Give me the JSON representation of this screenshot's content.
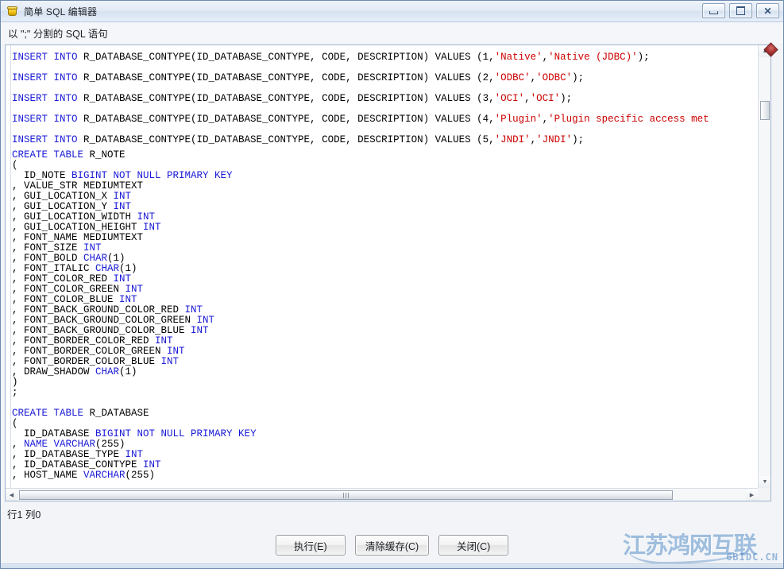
{
  "window": {
    "title": "简单 SQL 编辑器",
    "icon": "java-app-icon",
    "controls": {
      "minimize": "最小化",
      "maximize": "最大化",
      "close": "关闭"
    }
  },
  "label": {
    "text": "以 \";\" 分割的 SQL 语句"
  },
  "editor": {
    "lines": [
      {
        "spacing": "tall",
        "tokens": [
          {
            "t": "INSERT INTO ",
            "c": "kw"
          },
          {
            "t": "R_DATABASE_CONTYPE(ID_DATABASE_CONTYPE, CODE, DESCRIPTION) VALUES (1,",
            "c": "pl"
          },
          {
            "t": "'Native'",
            "c": "str"
          },
          {
            "t": ",",
            "c": "pl"
          },
          {
            "t": "'Native (JDBC)'",
            "c": "str"
          },
          {
            "t": ");",
            "c": "pl"
          }
        ]
      },
      {
        "spacing": "tall",
        "tokens": [
          {
            "t": "INSERT INTO ",
            "c": "kw"
          },
          {
            "t": "R_DATABASE_CONTYPE(ID_DATABASE_CONTYPE, CODE, DESCRIPTION) VALUES (2,",
            "c": "pl"
          },
          {
            "t": "'ODBC'",
            "c": "str"
          },
          {
            "t": ",",
            "c": "pl"
          },
          {
            "t": "'ODBC'",
            "c": "str"
          },
          {
            "t": ");",
            "c": "pl"
          }
        ]
      },
      {
        "spacing": "tall",
        "tokens": [
          {
            "t": "INSERT INTO ",
            "c": "kw"
          },
          {
            "t": "R_DATABASE_CONTYPE(ID_DATABASE_CONTYPE, CODE, DESCRIPTION) VALUES (3,",
            "c": "pl"
          },
          {
            "t": "'OCI'",
            "c": "str"
          },
          {
            "t": ",",
            "c": "pl"
          },
          {
            "t": "'OCI'",
            "c": "str"
          },
          {
            "t": ");",
            "c": "pl"
          }
        ]
      },
      {
        "spacing": "tall",
        "tokens": [
          {
            "t": "INSERT INTO ",
            "c": "kw"
          },
          {
            "t": "R_DATABASE_CONTYPE(ID_DATABASE_CONTYPE, CODE, DESCRIPTION) VALUES (4,",
            "c": "pl"
          },
          {
            "t": "'Plugin'",
            "c": "str"
          },
          {
            "t": ",",
            "c": "pl"
          },
          {
            "t": "'Plugin specific access met",
            "c": "str"
          }
        ]
      },
      {
        "spacing": "tall",
        "tokens": [
          {
            "t": "INSERT INTO ",
            "c": "kw"
          },
          {
            "t": "R_DATABASE_CONTYPE(ID_DATABASE_CONTYPE, CODE, DESCRIPTION) VALUES (5,",
            "c": "pl"
          },
          {
            "t": "'JNDI'",
            "c": "str"
          },
          {
            "t": ",",
            "c": "pl"
          },
          {
            "t": "'JNDI'",
            "c": "str"
          },
          {
            "t": ");",
            "c": "pl"
          }
        ]
      },
      {
        "spacing": "normal",
        "tokens": [
          {
            "t": "CREATE TABLE ",
            "c": "kw"
          },
          {
            "t": "R_NOTE",
            "c": "pl"
          }
        ]
      },
      {
        "spacing": "normal",
        "tokens": [
          {
            "t": "(",
            "c": "pl"
          }
        ]
      },
      {
        "spacing": "normal",
        "tokens": [
          {
            "t": "  ID_NOTE ",
            "c": "pl"
          },
          {
            "t": "BIGINT NOT NULL PRIMARY KEY",
            "c": "kw"
          }
        ]
      },
      {
        "spacing": "normal",
        "tokens": [
          {
            "t": ", VALUE_STR MEDIUMTEXT",
            "c": "pl"
          }
        ]
      },
      {
        "spacing": "normal",
        "tokens": [
          {
            "t": ", GUI_LOCATION_X ",
            "c": "pl"
          },
          {
            "t": "INT",
            "c": "kw"
          }
        ]
      },
      {
        "spacing": "normal",
        "tokens": [
          {
            "t": ", GUI_LOCATION_Y ",
            "c": "pl"
          },
          {
            "t": "INT",
            "c": "kw"
          }
        ]
      },
      {
        "spacing": "normal",
        "tokens": [
          {
            "t": ", GUI_LOCATION_WIDTH ",
            "c": "pl"
          },
          {
            "t": "INT",
            "c": "kw"
          }
        ]
      },
      {
        "spacing": "normal",
        "tokens": [
          {
            "t": ", GUI_LOCATION_HEIGHT ",
            "c": "pl"
          },
          {
            "t": "INT",
            "c": "kw"
          }
        ]
      },
      {
        "spacing": "normal",
        "tokens": [
          {
            "t": ", FONT_NAME MEDIUMTEXT",
            "c": "pl"
          }
        ]
      },
      {
        "spacing": "normal",
        "tokens": [
          {
            "t": ", FONT_SIZE ",
            "c": "pl"
          },
          {
            "t": "INT",
            "c": "kw"
          }
        ]
      },
      {
        "spacing": "normal",
        "tokens": [
          {
            "t": ", FONT_BOLD ",
            "c": "pl"
          },
          {
            "t": "CHAR",
            "c": "kw"
          },
          {
            "t": "(1)",
            "c": "pl"
          }
        ]
      },
      {
        "spacing": "normal",
        "tokens": [
          {
            "t": ", FONT_ITALIC ",
            "c": "pl"
          },
          {
            "t": "CHAR",
            "c": "kw"
          },
          {
            "t": "(1)",
            "c": "pl"
          }
        ]
      },
      {
        "spacing": "normal",
        "tokens": [
          {
            "t": ", FONT_COLOR_RED ",
            "c": "pl"
          },
          {
            "t": "INT",
            "c": "kw"
          }
        ]
      },
      {
        "spacing": "normal",
        "tokens": [
          {
            "t": ", FONT_COLOR_GREEN ",
            "c": "pl"
          },
          {
            "t": "INT",
            "c": "kw"
          }
        ]
      },
      {
        "spacing": "normal",
        "tokens": [
          {
            "t": ", FONT_COLOR_BLUE ",
            "c": "pl"
          },
          {
            "t": "INT",
            "c": "kw"
          }
        ]
      },
      {
        "spacing": "normal",
        "tokens": [
          {
            "t": ", FONT_BACK_GROUND_COLOR_RED ",
            "c": "pl"
          },
          {
            "t": "INT",
            "c": "kw"
          }
        ]
      },
      {
        "spacing": "normal",
        "tokens": [
          {
            "t": ", FONT_BACK_GROUND_COLOR_GREEN ",
            "c": "pl"
          },
          {
            "t": "INT",
            "c": "kw"
          }
        ]
      },
      {
        "spacing": "normal",
        "tokens": [
          {
            "t": ", FONT_BACK_GROUND_COLOR_BLUE ",
            "c": "pl"
          },
          {
            "t": "INT",
            "c": "kw"
          }
        ]
      },
      {
        "spacing": "normal",
        "tokens": [
          {
            "t": ", FONT_BORDER_COLOR_RED ",
            "c": "pl"
          },
          {
            "t": "INT",
            "c": "kw"
          }
        ]
      },
      {
        "spacing": "normal",
        "tokens": [
          {
            "t": ", FONT_BORDER_COLOR_GREEN ",
            "c": "pl"
          },
          {
            "t": "INT",
            "c": "kw"
          }
        ]
      },
      {
        "spacing": "normal",
        "tokens": [
          {
            "t": ", FONT_BORDER_COLOR_BLUE ",
            "c": "pl"
          },
          {
            "t": "INT",
            "c": "kw"
          }
        ]
      },
      {
        "spacing": "normal",
        "tokens": [
          {
            "t": ", DRAW_SHADOW ",
            "c": "pl"
          },
          {
            "t": "CHAR",
            "c": "kw"
          },
          {
            "t": "(1)",
            "c": "pl"
          }
        ]
      },
      {
        "spacing": "normal",
        "tokens": [
          {
            "t": ")",
            "c": "pl"
          }
        ]
      },
      {
        "spacing": "normal",
        "tokens": [
          {
            "t": ";",
            "c": "pl"
          }
        ]
      },
      {
        "spacing": "normal",
        "tokens": [
          {
            "t": "",
            "c": "pl"
          }
        ]
      },
      {
        "spacing": "normal",
        "tokens": [
          {
            "t": "CREATE TABLE ",
            "c": "kw"
          },
          {
            "t": "R_DATABASE",
            "c": "pl"
          }
        ]
      },
      {
        "spacing": "normal",
        "tokens": [
          {
            "t": "(",
            "c": "pl"
          }
        ]
      },
      {
        "spacing": "normal",
        "tokens": [
          {
            "t": "  ID_DATABASE ",
            "c": "pl"
          },
          {
            "t": "BIGINT NOT NULL PRIMARY KEY",
            "c": "kw"
          }
        ]
      },
      {
        "spacing": "normal",
        "tokens": [
          {
            "t": ", ",
            "c": "pl"
          },
          {
            "t": "NAME VARCHAR",
            "c": "kw"
          },
          {
            "t": "(255)",
            "c": "pl"
          }
        ]
      },
      {
        "spacing": "normal",
        "tokens": [
          {
            "t": ", ID_DATABASE_TYPE ",
            "c": "pl"
          },
          {
            "t": "INT",
            "c": "kw"
          }
        ]
      },
      {
        "spacing": "normal",
        "tokens": [
          {
            "t": ", ID_DATABASE_CONTYPE ",
            "c": "pl"
          },
          {
            "t": "INT",
            "c": "kw"
          }
        ]
      },
      {
        "spacing": "normal",
        "tokens": [
          {
            "t": ", HOST_NAME ",
            "c": "pl"
          },
          {
            "t": "VARCHAR",
            "c": "kw"
          },
          {
            "t": "(255)",
            "c": "pl"
          }
        ]
      }
    ],
    "scrollbars": {
      "vertical_arrow_up": "▲",
      "vertical_arrow_down": "▼",
      "horizontal_arrow_left": "◀",
      "horizontal_arrow_right": "▶"
    },
    "marker": "error-marker"
  },
  "status": {
    "text": "行1 列0"
  },
  "buttons": {
    "execute": "执行(E)",
    "clear_cache": "清除缓存(C)",
    "close": "关闭(C)"
  },
  "watermark": {
    "title": "江苏鸿网互联",
    "domain": "6BIDC.CN"
  },
  "colors": {
    "keyword": "#1a1ad6",
    "string": "#cc0000",
    "plain": "#000000",
    "window_border": "#6d8ab0",
    "watermark": "#568cc4"
  }
}
